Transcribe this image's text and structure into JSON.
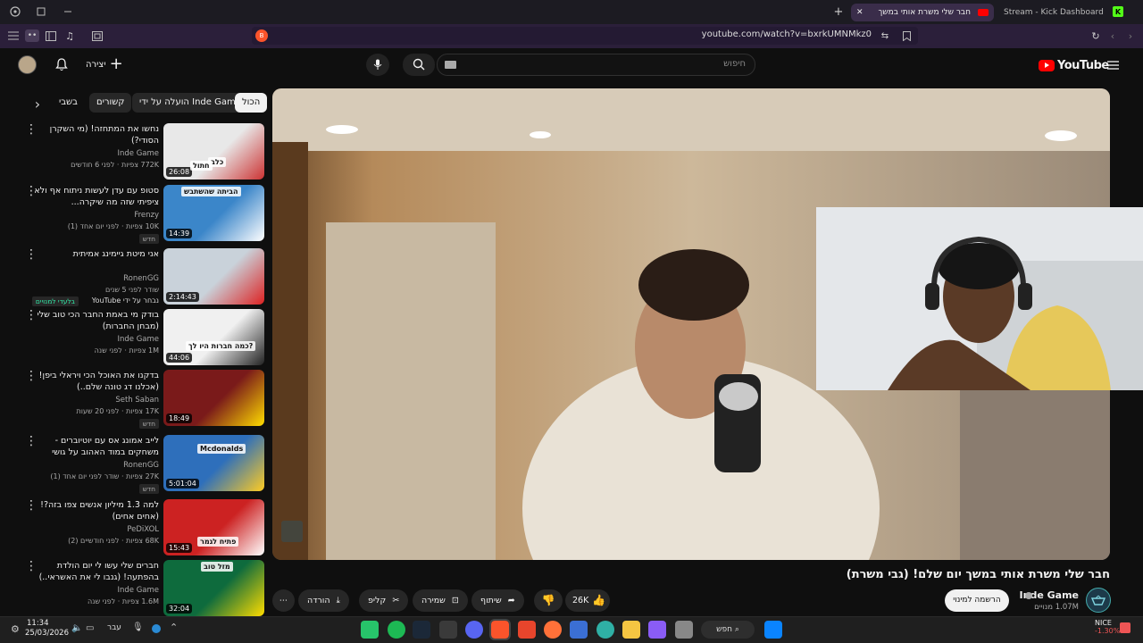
{
  "browser": {
    "tabs": [
      {
        "label": "Stream - Kick Dashboard"
      },
      {
        "label": "חבר שלי משרת אותי במשך"
      }
    ],
    "new_tab_label": "+",
    "url": "youtube.com/watch?v=bxrkUMNMkz0",
    "colors": {
      "tab_bg": "#1c1b22",
      "toolbar_bg": "#2b1f3a"
    }
  },
  "youtube": {
    "logo": "YouTube",
    "create_label": "יצירה",
    "search_placeholder": "חיפוש",
    "chips": [
      "הכול",
      "הועלה על ידי Inde Game",
      "קשורים",
      "בשבי"
    ],
    "sidebar_videos": [
      {
        "title": "נחשו את המתחזה! (מי השקרן הסודי?)",
        "channel": "Inde Game",
        "meta": "772K צפיות · לפני 6 חודשים",
        "duration": "26:08",
        "badge": ""
      },
      {
        "title": "סטופ עם עדן לעשות ניתוח אף ולא ציפיתי שזה מה שיקרה...",
        "channel": "Frenzy",
        "meta": "10K צפיות · לפני יום אחד (1)",
        "duration": "14:39",
        "badge": "חדש"
      },
      {
        "title": "אני מיטת גיימינג אמיתית",
        "channel": "RonenGG",
        "meta": "שודר לפני 5 שנים",
        "duration": "2:14:43",
        "badge": "",
        "extra": "נבחר על ידי YouTube",
        "extra2": "בלעדי למנויים"
      },
      {
        "title": "בודק מי באמת החבר הכי טוב שלי (מבחן החברות)",
        "channel": "Inde Game",
        "meta": "1M צפיות · לפני שנה",
        "duration": "44:06",
        "badge": ""
      },
      {
        "title": "בדקנו את האוכל הכי ויראלי ביפן! (אכלנו דג טונה שלם..)",
        "channel": "Seth Saban",
        "meta": "17K צפיות · לפני 20 שעות",
        "duration": "18:49",
        "badge": "חדש"
      },
      {
        "title": "לייב אמונג אס עם יוטיוברים - משחקים במוד האהוב על גושי",
        "channel": "RonenGG",
        "meta": "27K צפיות · שודר לפני יום אחד (1)",
        "duration": "5:01:04",
        "badge": "חדש"
      },
      {
        "title": "למה 1.3 מיליון אנשים צפו בזה?! (אחים אחים)",
        "channel": "PeDiXOL",
        "meta": "68K צפיות · לפני חודשיים (2)",
        "duration": "15:43",
        "badge": ""
      },
      {
        "title": "חברים שלי עשו לי יום הולדת בהפתעה! (גנבו לי את האשראי..)",
        "channel": "Inde Game",
        "meta": "1.6M צפיות · לפני שנה",
        "duration": "32:04",
        "badge": ""
      }
    ],
    "thumb_texts": [
      "כלב",
      "חתול",
      "הביתה שהשתבש",
      "כמה חברות היו לך?",
      "Mcdonalds",
      "פתיח לגמר",
      "מזל טוב"
    ],
    "video": {
      "title": "חבר שלי משרת אותי במשך יום שלם! (גבי משרת)",
      "channel": "Inde Game",
      "subscribers": "1.07M מנויים",
      "subscribe_label": "הרשמה למינוי",
      "likes": "26K",
      "share_label": "שיתוף",
      "save_label": "שמירה",
      "clip_label": "קליפ",
      "download_label": "הורדה"
    }
  },
  "taskbar": {
    "time": "11:34",
    "date": "25/03/2026",
    "lang": "עבר",
    "search_label": "חפש",
    "stock_name": "NICE",
    "stock_change": "-1.30%"
  }
}
